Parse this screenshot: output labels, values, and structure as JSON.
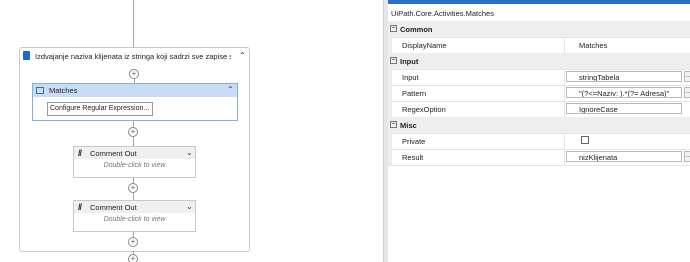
{
  "designer": {
    "sequence_title": "Izdvajanje naziva klijenata iz stringa koji sadrzi sve zapise sa s",
    "matches_title": "Matches",
    "configure_button": "Configure Regular Expression...",
    "comments": [
      {
        "title": "Comment Out",
        "hint": "Double-click to view"
      },
      {
        "title": "Comment Out",
        "hint": "Double-click to view"
      }
    ]
  },
  "properties": {
    "type_name": "UiPath.Core.Activities.Matches",
    "categories": {
      "common": "Common",
      "input": "Input",
      "misc": "Misc"
    },
    "rows": {
      "display_name": {
        "label": "DisplayName",
        "value": "Matches"
      },
      "input": {
        "label": "Input",
        "value": "stringTabela"
      },
      "pattern": {
        "label": "Pattern",
        "value": "\"(?<=Naziv: ).*(?= Adresa)\""
      },
      "regex_option": {
        "label": "RegexOption",
        "value": "IgnoreCase"
      },
      "private": {
        "label": "Private",
        "checked": false
      },
      "result": {
        "label": "Result",
        "value": "nizKlijenata"
      }
    },
    "accent_color": "#2f6fc7"
  }
}
